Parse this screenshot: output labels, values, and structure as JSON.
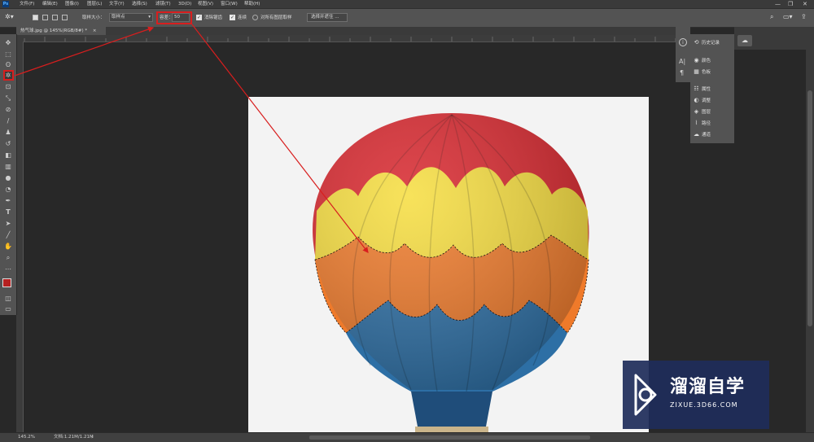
{
  "app": {
    "logo": "Ps"
  },
  "menu": [
    "文件(F)",
    "编辑(E)",
    "图像(I)",
    "图层(L)",
    "文字(Y)",
    "选择(S)",
    "滤镜(T)",
    "3D(D)",
    "视图(V)",
    "窗口(W)",
    "帮助(H)"
  ],
  "window_controls": {
    "minimize": "—",
    "restore": "❐",
    "close": "✕"
  },
  "options": {
    "sample_size_label": "取样大小：",
    "sample_size_value": "取样点",
    "tolerance_label": "容差：",
    "tolerance_value": "50",
    "antialias_label": "消除锯齿",
    "contiguous_label": "连续",
    "sample_all_label": "对所有图层取样",
    "select_mask_button": "选择并遮住 ..."
  },
  "document": {
    "tab_title": "热气球.jpg @ 145%(RGB/8#) *",
    "tab_close": "×"
  },
  "panels": {
    "items": [
      {
        "icon": "history-icon",
        "label": "历史记录"
      },
      {
        "icon": "color-icon",
        "label": "颜色"
      },
      {
        "icon": "swatches-icon",
        "label": "色板"
      },
      {
        "icon": "properties-icon",
        "label": "属性"
      },
      {
        "icon": "adjustments-icon",
        "label": "调整"
      },
      {
        "icon": "layers-icon",
        "label": "图层"
      },
      {
        "icon": "paths-icon",
        "label": "路径"
      },
      {
        "icon": "channels-icon",
        "label": "通道"
      }
    ]
  },
  "status": {
    "zoom": "145.2%",
    "doc_size": "文档:1.21M/1.21M"
  },
  "watermark": {
    "title": "溜溜自学",
    "url": "ZIXUE.3D66.COM"
  },
  "colors": {
    "annotation_red": "#d81e1e",
    "foreground_swatch": "#b52020",
    "background_swatch": "#111111"
  }
}
